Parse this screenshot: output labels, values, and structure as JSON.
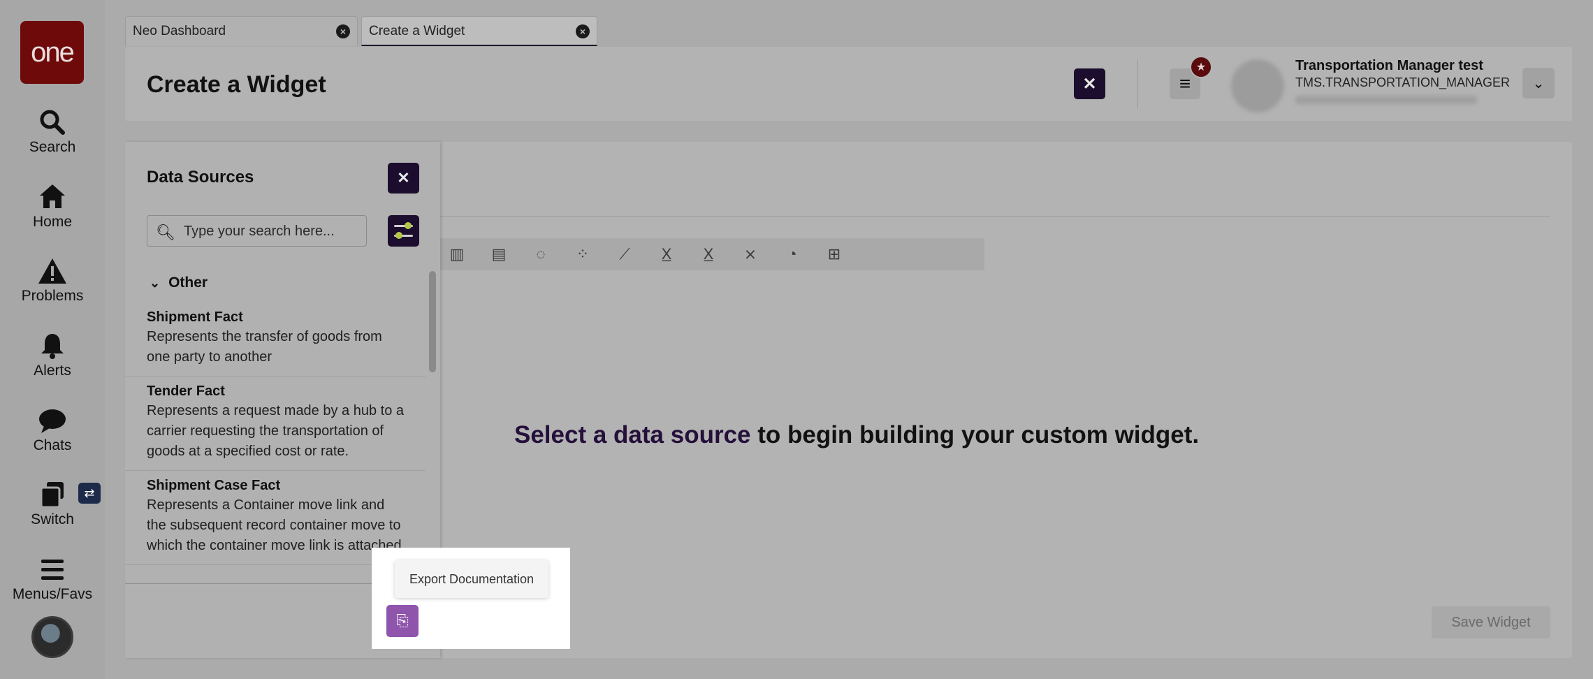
{
  "app": {
    "logo_text": "one",
    "brand_color": "#6e0a0a",
    "accent": "#1c0d2e"
  },
  "leftnav": {
    "items": [
      {
        "label": "Search",
        "icon": "search-icon"
      },
      {
        "label": "Home",
        "icon": "home-icon"
      },
      {
        "label": "Problems",
        "icon": "warning-icon"
      },
      {
        "label": "Alerts",
        "icon": "bell-icon"
      },
      {
        "label": "Chats",
        "icon": "chat-icon"
      },
      {
        "label": "Switch",
        "icon": "switch-icon"
      },
      {
        "label": "Menus/Favs",
        "icon": "menu-icon"
      }
    ]
  },
  "tabs": [
    {
      "label": "Neo Dashboard"
    },
    {
      "label": "Create a Widget"
    }
  ],
  "header": {
    "title": "Create a Widget",
    "user_name": "Transportation Manager test",
    "user_role": "TMS.TRANSPORTATION_MANAGER"
  },
  "data_sources": {
    "title": "Data Sources",
    "search_placeholder": "Type your search here...",
    "group": "Other",
    "items": [
      {
        "name": "Shipment Fact",
        "desc": "Represents the transfer of goods from one party to another"
      },
      {
        "name": "Tender Fact",
        "desc": "Represents a request made by a hub to a carrier requesting the transportation of goods at a specified cost or rate."
      },
      {
        "name": "Shipment Case Fact",
        "desc": "Represents a Container move link and the subsequent record container move to which the container move link is attached"
      }
    ]
  },
  "main": {
    "prompt_highlight": "Select a data source",
    "prompt_rest": " to begin building your custom widget.",
    "save_label": "Save Widget"
  },
  "tooltip": {
    "text": "Export Documentation"
  }
}
